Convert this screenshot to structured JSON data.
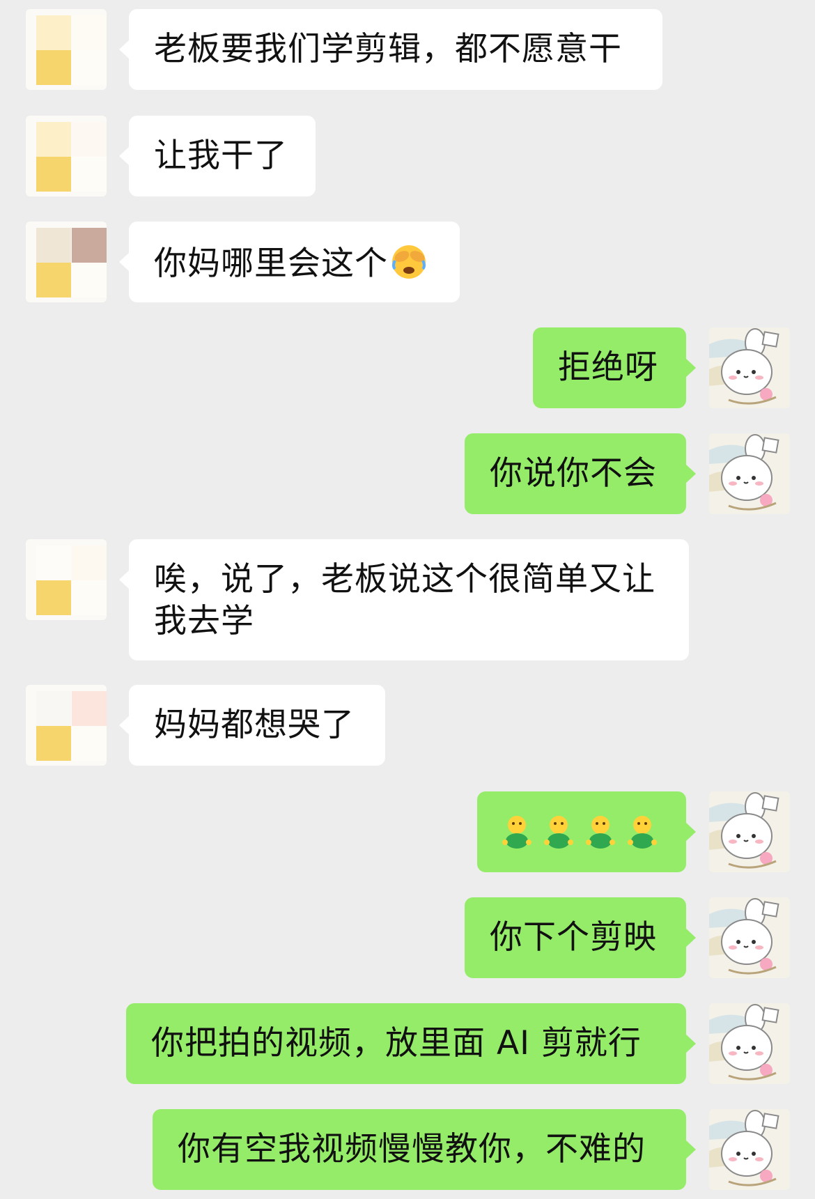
{
  "chat": {
    "messages": [
      {
        "side": "in",
        "text": "老板要我们学剪辑，都不愿意干"
      },
      {
        "side": "in",
        "text": "让我干了"
      },
      {
        "side": "in",
        "text": "你妈哪里会这个",
        "emoji": "face-exhaling-tears-icon"
      },
      {
        "side": "out",
        "text": "拒绝呀"
      },
      {
        "side": "out",
        "text": "你说你不会"
      },
      {
        "side": "in",
        "text": "唉，说了，老板说这个很简单又让我去学"
      },
      {
        "side": "in",
        "text": "妈妈都想哭了"
      },
      {
        "side": "out",
        "emoji_sequence": [
          "green-figure-emoji",
          "green-figure-emoji",
          "green-figure-emoji",
          "green-figure-emoji"
        ]
      },
      {
        "side": "out",
        "text": "你下个剪映"
      },
      {
        "side": "out",
        "text": "你把拍的视频，放里面 AI 剪就行"
      },
      {
        "side": "out",
        "text": "你有空我视频慢慢教你，不难的"
      }
    ]
  },
  "colors": {
    "background": "#ededed",
    "incoming_bubble": "#ffffff",
    "outgoing_bubble": "#95ec69",
    "text": "#111111"
  }
}
